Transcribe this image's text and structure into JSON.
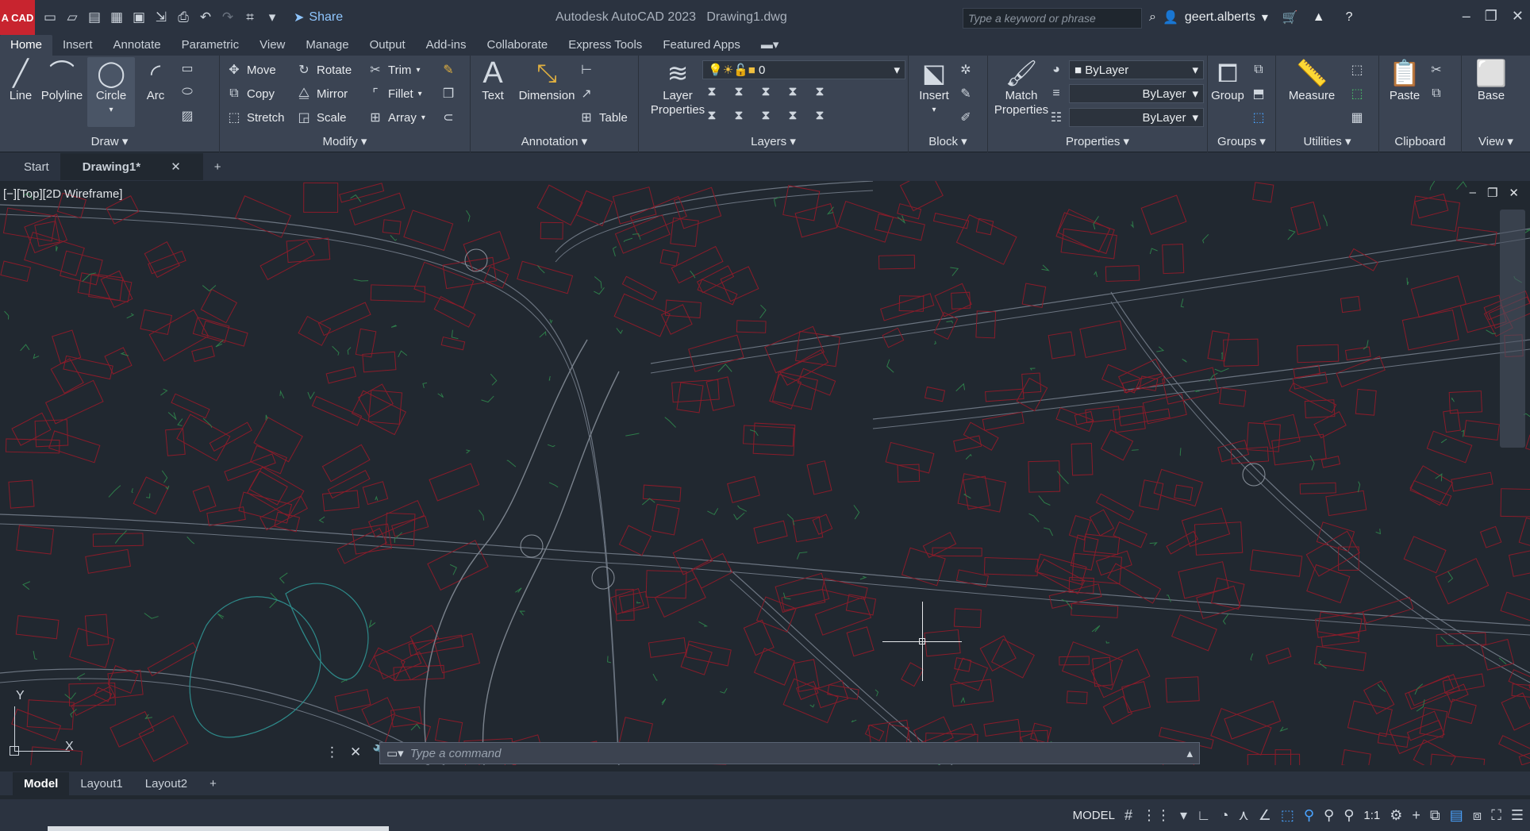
{
  "titlebar": {
    "logo": "A CAD",
    "share_label": "Share",
    "app_title": "Autodesk AutoCAD 2023",
    "file_name": "Drawing1.dwg",
    "search_placeholder": "Type a keyword or phrase",
    "username": "geert.alberts"
  },
  "ribbon_tabs": [
    "Home",
    "Insert",
    "Annotate",
    "Parametric",
    "View",
    "Manage",
    "Output",
    "Add-ins",
    "Collaborate",
    "Express Tools",
    "Featured Apps"
  ],
  "draw": {
    "line": "Line",
    "polyline": "Polyline",
    "circle": "Circle",
    "arc": "Arc",
    "label": "Draw"
  },
  "modify": {
    "move": "Move",
    "rotate": "Rotate",
    "trim": "Trim",
    "copy": "Copy",
    "mirror": "Mirror",
    "fillet": "Fillet",
    "stretch": "Stretch",
    "scale": "Scale",
    "array": "Array",
    "label": "Modify"
  },
  "annotation": {
    "text": "Text",
    "dimension": "Dimension",
    "table": "Table",
    "label": "Annotation"
  },
  "layers": {
    "layer_properties": "Layer Properties",
    "current_layer": "0",
    "label": "Layers"
  },
  "block": {
    "insert": "Insert",
    "label": "Block"
  },
  "properties": {
    "match": "Match Properties",
    "color": "ByLayer",
    "linetype": "ByLayer",
    "lineweight": "ByLayer",
    "label": "Properties"
  },
  "groups": {
    "group": "Group",
    "label": "Groups"
  },
  "utilities": {
    "measure": "Measure",
    "label": "Utilities"
  },
  "clipboard": {
    "paste": "Paste",
    "label": "Clipboard"
  },
  "view": {
    "base": "Base",
    "label": "View"
  },
  "doc_tabs": {
    "start": "Start",
    "drawing": "Drawing1*"
  },
  "viewport": {
    "label": "[−][Top][2D Wireframe]",
    "axis_y": "Y",
    "axis_x": "X"
  },
  "command": {
    "placeholder": "Type a command"
  },
  "layout_tabs": [
    "Model",
    "Layout1",
    "Layout2"
  ],
  "status": {
    "model": "MODEL",
    "scale": "1:1"
  },
  "colors": {
    "accent": "#4aa3ff",
    "logo": "#c8242f",
    "building": "#8a1c2a",
    "green": "#2e7d4a"
  }
}
